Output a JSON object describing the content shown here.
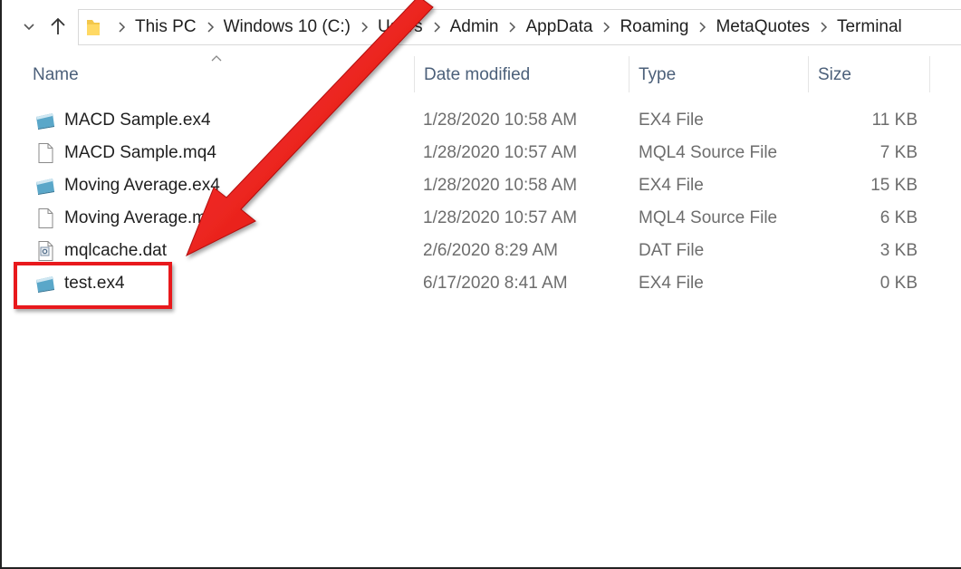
{
  "address_bar": {
    "breadcrumbs": [
      "This PC",
      "Windows 10 (C:)",
      "Users",
      "Admin",
      "AppData",
      "Roaming",
      "MetaQuotes",
      "Terminal"
    ]
  },
  "columns": {
    "name": "Name",
    "date_modified": "Date modified",
    "type": "Type",
    "size": "Size"
  },
  "files": [
    {
      "name": "MACD Sample.ex4",
      "date": "1/28/2020 10:58 AM",
      "type": "EX4 File",
      "size": "11 KB",
      "icon": "ex4-file-icon"
    },
    {
      "name": "MACD Sample.mq4",
      "date": "1/28/2020 10:57 AM",
      "type": "MQL4 Source File",
      "size": "7 KB",
      "icon": "document-file-icon"
    },
    {
      "name": "Moving Average.ex4",
      "date": "1/28/2020 10:58 AM",
      "type": "EX4 File",
      "size": "15 KB",
      "icon": "ex4-file-icon"
    },
    {
      "name": "Moving Average.mq4",
      "date": "1/28/2020 10:57 AM",
      "type": "MQL4 Source File",
      "size": "6 KB",
      "icon": "document-file-icon"
    },
    {
      "name": "mqlcache.dat",
      "date": "2/6/2020 8:29 AM",
      "type": "DAT File",
      "size": "3 KB",
      "icon": "dat-file-icon"
    },
    {
      "name": "test.ex4",
      "date": "6/17/2020 8:41 AM",
      "type": "EX4 File",
      "size": "0 KB",
      "icon": "ex4-file-icon"
    }
  ],
  "colors": {
    "annotation_red": "#e8191c",
    "header_text": "#4c607a",
    "secondary_text": "#6d6d6d"
  }
}
